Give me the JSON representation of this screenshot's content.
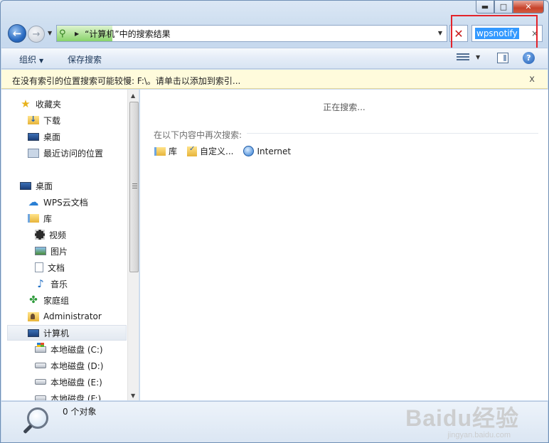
{
  "address": {
    "path": "“计算机”中的搜索结果"
  },
  "search": {
    "value": "wpsnotify",
    "clear": "×"
  },
  "caption": {
    "min": "▬",
    "max": "□",
    "close": "✕"
  },
  "toolbar": {
    "organize": "组织",
    "save_search": "保存搜索",
    "help": "?"
  },
  "infobar": {
    "text": "在没有索引的位置搜索可能较慢: F:\\。请单击以添加到索引...",
    "close": "x"
  },
  "nav": {
    "favorites": "收藏夹",
    "downloads": "下载",
    "desktop_fav": "桌面",
    "recent": "最近访问的位置",
    "desktop": "桌面",
    "wps_cloud": "WPS云文档",
    "libraries": "库",
    "videos": "视频",
    "pictures": "图片",
    "documents": "文档",
    "music": "音乐",
    "homegroup": "家庭组",
    "administrator": "Administrator",
    "computer": "计算机",
    "drive_c": "本地磁盘 (C:)",
    "drive_d": "本地磁盘 (D:)",
    "drive_e": "本地磁盘 (E:)",
    "drive_f": "本地磁盘 (F:)"
  },
  "content": {
    "searching": "正在搜索...",
    "search_again": "在以下内容中再次搜索:",
    "locations": [
      "库",
      "自定义...",
      "Internet"
    ]
  },
  "status": {
    "count": "0 个对象"
  },
  "watermark": {
    "logo": "Baidu经验",
    "url": "jingyan.baidu.com"
  },
  "icons": [
    "back-arrow-icon",
    "forward-arrow-icon",
    "search-icon",
    "stop-icon",
    "views-icon",
    "preview-pane-icon",
    "help-icon",
    "magnifier-icon"
  ]
}
